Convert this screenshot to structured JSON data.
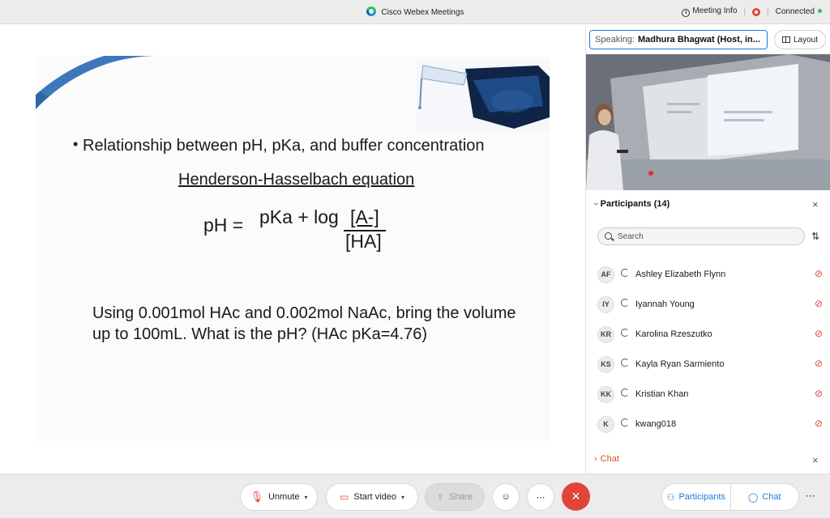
{
  "window": {
    "title": "Cisco Webex Meetings",
    "meeting_info": "Meeting Info",
    "connection_status": "Connected"
  },
  "slide": {
    "bullet": "Relationship between pH, pKa, and buffer concentration",
    "equation_title": "Henderson-Hasselbach equation",
    "equation_lhs": "pH =",
    "equation_numerator": "pKa + log",
    "equation_A": "[A-]",
    "equation_denominator": "[HA]",
    "problem": "Using 0.001mol HAc and 0.002mol NaAc, bring the volume up to 100mL. What is the pH? (HAc pKa=4.76)"
  },
  "panel": {
    "speaking_label": "Speaking:",
    "speaker_name": "Madhura Bhagwat (Host, in...",
    "layout_label": "Layout",
    "participants_title": "Participants (14)",
    "search_placeholder": "Search",
    "participants": [
      {
        "initials": "AF",
        "name": "Ashley Elizabeth Flynn"
      },
      {
        "initials": "IY",
        "name": "Iyannah Young"
      },
      {
        "initials": "KR",
        "name": "Karolina Rzeszutko"
      },
      {
        "initials": "KS",
        "name": "Kayla Ryan Sarmiento"
      },
      {
        "initials": "KK",
        "name": "Kristian Khan"
      },
      {
        "initials": "K",
        "name": "kwang018"
      }
    ],
    "chat_label": "Chat"
  },
  "toolbar": {
    "unmute": "Unmute",
    "start_video": "Start video",
    "share": "Share",
    "participants": "Participants",
    "chat": "Chat"
  },
  "colors": {
    "accent": "#1a7ce0",
    "danger": "#e0453b",
    "chat": "#d2572a",
    "connected": "#2dbd6e"
  }
}
